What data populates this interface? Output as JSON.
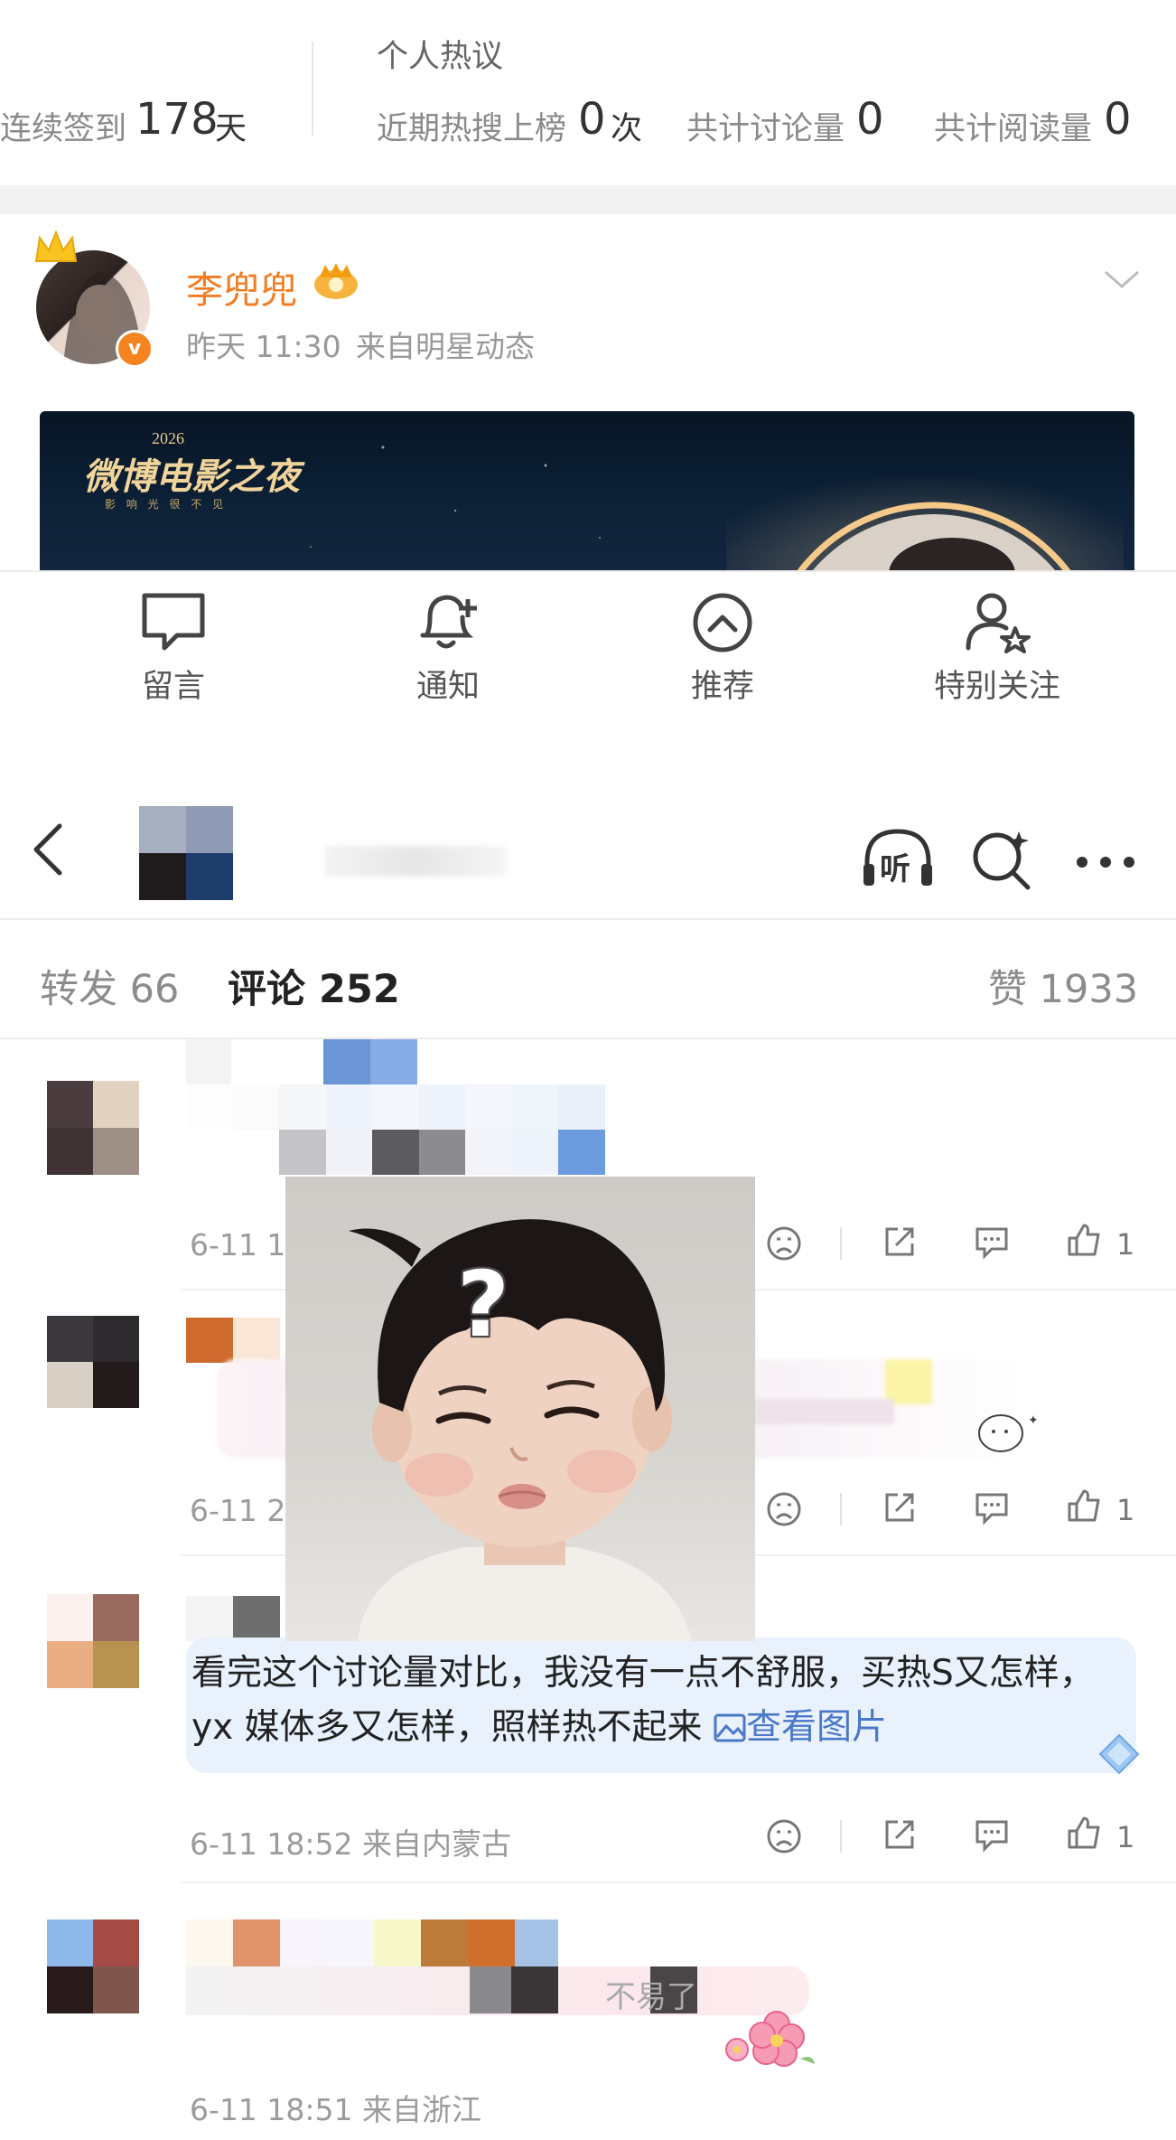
{
  "stats": {
    "signin_label": "连续签到",
    "signin_value": "178",
    "signin_unit": "天",
    "section_title": "个人热议",
    "hot_label": "近期热搜上榜",
    "hot_value": "0",
    "hot_unit": "次",
    "discuss_label": "共计讨论量",
    "discuss_value": "0",
    "read_label": "共计阅读量",
    "read_value": "0"
  },
  "post": {
    "author": "李兜兜",
    "time": "昨天 11:30",
    "source": "来自明星动态",
    "banner_title": "微博电影之夜",
    "banner_year": "2026",
    "banner_sub": "影 响 光 很 不 见"
  },
  "actions": [
    {
      "label": "留言",
      "icon": "message-icon"
    },
    {
      "label": "通知",
      "icon": "bell-plus-icon"
    },
    {
      "label": "推荐",
      "icon": "chevron-up-circle-icon"
    },
    {
      "label": "特别关注",
      "icon": "user-star-icon"
    }
  ],
  "nav": {
    "back_icon": "back-arrow-icon",
    "listen_label": "听",
    "search_icon": "search-icon",
    "more_icon": "more-icon"
  },
  "tabs": {
    "repost_label": "转发",
    "repost_count": "66",
    "comment_label": "评论",
    "comment_count": "252",
    "like_label": "赞",
    "like_count": "1933"
  },
  "comments": [
    {
      "meta": "6-11 14",
      "likes": "1"
    },
    {
      "meta": "6-11 2",
      "likes": "1"
    },
    {
      "text": "看完这个讨论量对比，我没有一点不舒服，买热S又怎样，yx 媒体多又怎样，照样热不起来",
      "view_image": "查看图片",
      "meta": "6-11 18:52 来自内蒙古",
      "likes": "1"
    },
    {
      "partial_text": "不易了",
      "meta": "6-11 18:51 来自浙江"
    }
  ],
  "popup": {
    "question_mark": "?"
  },
  "colors": {
    "author_orange": "#f27c22",
    "link_blue": "#4a78c8",
    "bubble_bg": "#e9f1fd"
  }
}
